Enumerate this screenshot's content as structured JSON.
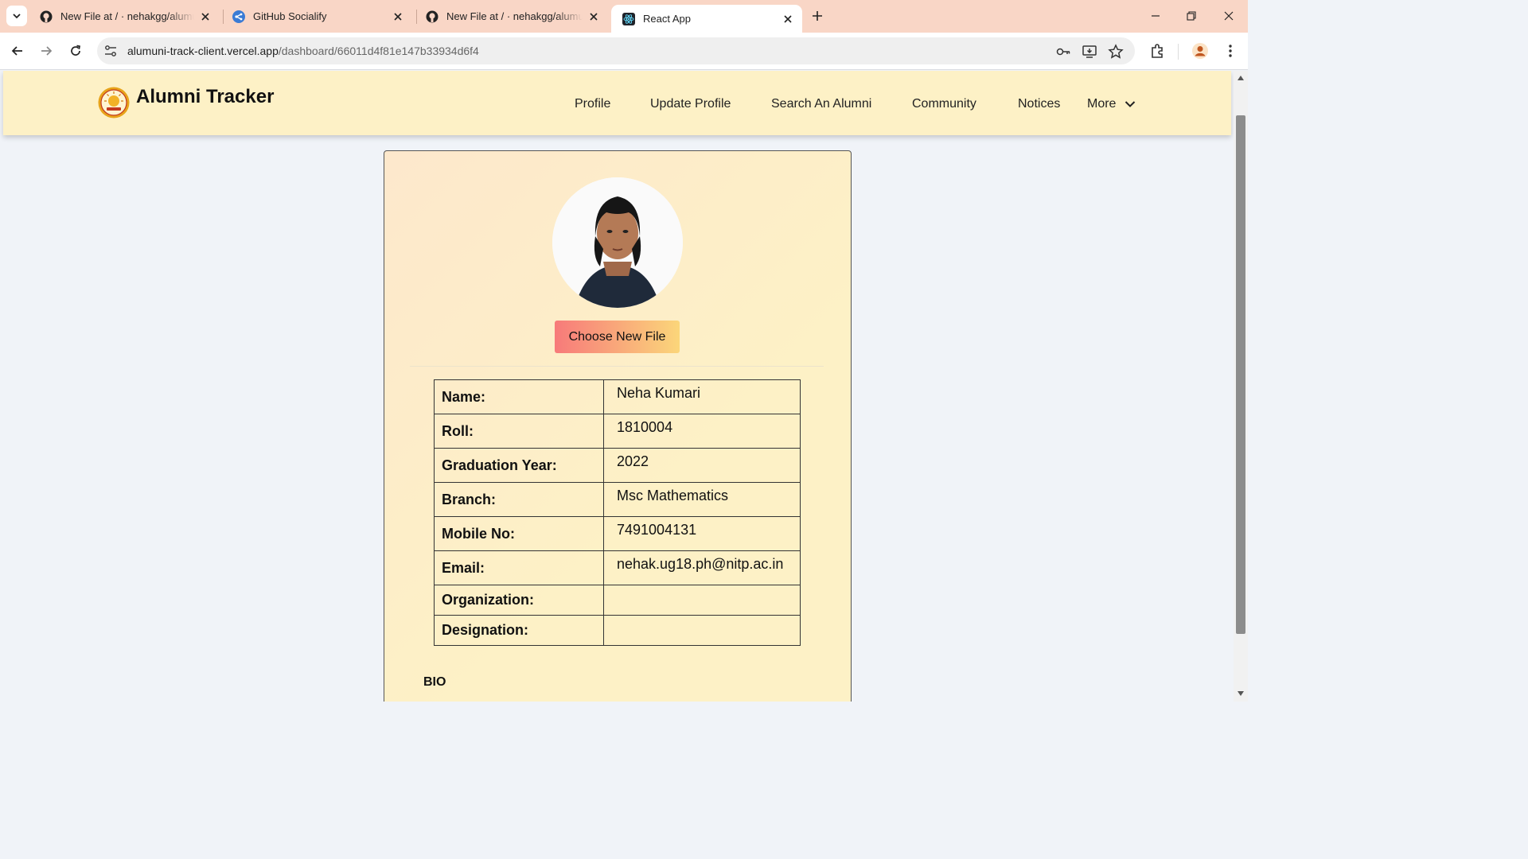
{
  "browser": {
    "tabs": [
      {
        "title": "New File at / · nehakgg/alumun",
        "icon": "github-icon",
        "active": false
      },
      {
        "title": "GitHub Socialify",
        "icon": "socialify-icon",
        "active": false
      },
      {
        "title": "New File at / · nehakgg/alumun",
        "icon": "github-icon",
        "active": false
      },
      {
        "title": "React App",
        "icon": "react-icon",
        "active": true
      }
    ],
    "url_host": "alumuni-track-client.vercel.app",
    "url_path": "/dashboard/66011d4f81e147b33934d6f4"
  },
  "site": {
    "brand": "Alumni Tracker",
    "nav": [
      "Profile",
      "Update Profile",
      "Search An Alumni",
      "Community",
      "Notices",
      "More"
    ]
  },
  "profile": {
    "choose_file_label": "Choose New File",
    "rows": [
      {
        "label": "Name:",
        "value": "Neha Kumari"
      },
      {
        "label": "Roll:",
        "value": "1810004"
      },
      {
        "label": "Graduation Year:",
        "value": "2022"
      },
      {
        "label": "Branch:",
        "value": "Msc Mathematics"
      },
      {
        "label": "Mobile No:",
        "value": "7491004131"
      },
      {
        "label": "Email:",
        "value": "nehak.ug18.ph@nitp.ac.in"
      },
      {
        "label": "Organization:",
        "value": ""
      },
      {
        "label": "Designation:",
        "value": ""
      }
    ],
    "bio_heading": "BIO"
  },
  "colors": {
    "header_bg": "#fdf1c6",
    "tabstrip_bg": "#f9d6c6",
    "page_bg": "#f0f3f8",
    "button_gradient_start": "#f77a7a",
    "button_gradient_end": "#fbd67a"
  }
}
